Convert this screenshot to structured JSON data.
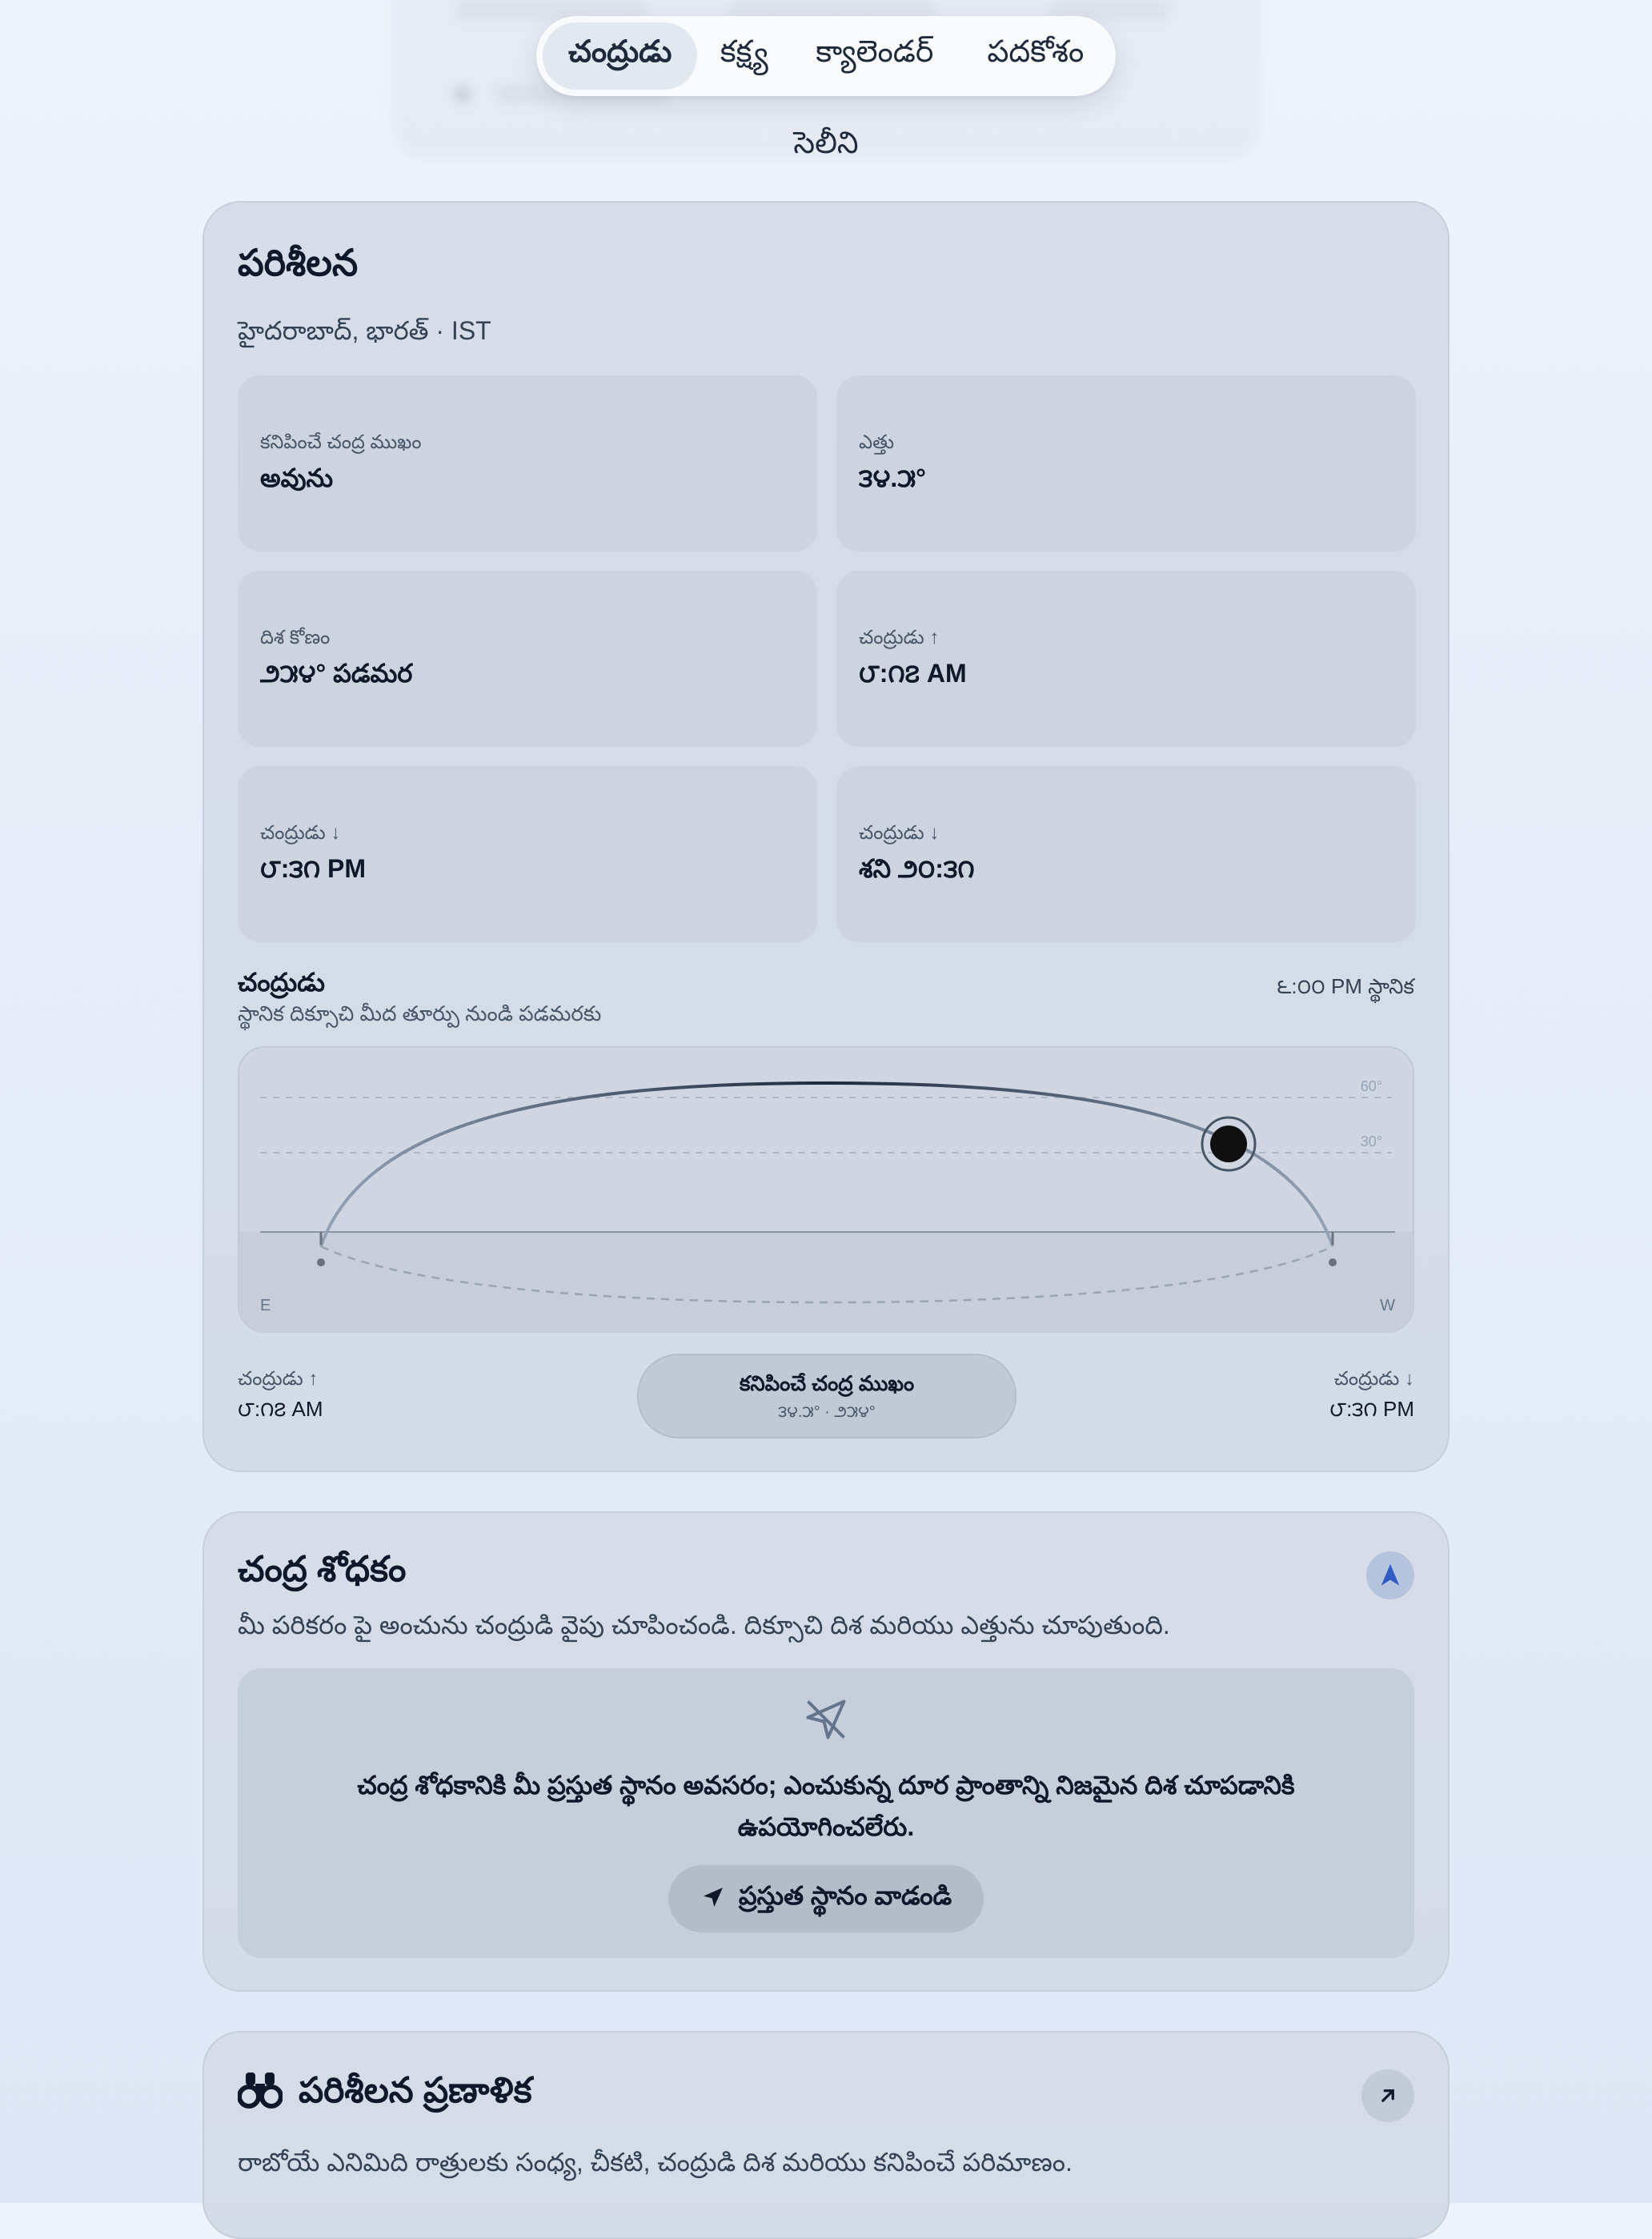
{
  "nav": {
    "tabs": [
      {
        "label": "చంద్రుడు",
        "active": true
      },
      {
        "label": "కక్ష్య"
      },
      {
        "label": "క్యాలెండర్"
      },
      {
        "label": "పదకోశం"
      }
    ],
    "section_title": "సెలీని"
  },
  "observation": {
    "title": "పరిశీలన",
    "location": "హైదరాబాద్, భారత్ · IST",
    "stats": [
      {
        "label": "కనిపించే చంద్ర ముఖం",
        "value": "అవును"
      },
      {
        "label": "ఎత్తు",
        "value": "౩౪.౫°"
      },
      {
        "label": "దిశ కోణం",
        "value": "౨౫౪° పడమర"
      },
      {
        "label": "చంద్రుడు ↑",
        "value": "౮:౧౭ AM"
      },
      {
        "label": "చంద్రుడు ↓",
        "value": "౮:౩౧ PM"
      },
      {
        "label": "చంద్రుడు ↓",
        "value": "శని ౨౦:౩౧"
      }
    ],
    "sky": {
      "title": "చంద్రుడు",
      "subtitle": "స్థానిక దిక్సూచి మీద తూర్పు నుండి పడమరకు",
      "time": "౬:౦౦ PM స్థానిక",
      "grid_60": "60°",
      "grid_30": "30°",
      "east": "E",
      "west": "W",
      "moon_altitude_deg": 34.5
    },
    "footer": {
      "rise_label": "చంద్రుడు ↑",
      "rise_time": "౮:౧౭ AM",
      "set_label": "చంద్రుడు ↓",
      "set_time": "౮:౩౧ PM",
      "pill_title": "కనిపించే చంద్ర ముఖం",
      "pill_sub": "౩౪.౫° · ౨౫౪°"
    }
  },
  "finder": {
    "title": "చంద్ర శోధకం",
    "description": "మీ పరికరం పై అంచును చంద్రుడి వైపు చూపించండి. దిక్సూచి దిశ మరియు ఎత్తును చూపుతుంది.",
    "message_line1": "చంద్ర శోధకానికి మీ ప్రస్తుత స్థానం అవసరం; ఎంచుకున్న దూర ప్రాంతాన్ని నిజమైన దిశ చూపడానికి",
    "message_line2": "ఉపయోగించలేరు.",
    "button": "ప్రస్తుత స్థానం వాడండి"
  },
  "planner": {
    "title": "పరిశీలన ప్రణాళిక",
    "description": "రాబోయే ఎనిమిది రాత్రులకు సంధ్య, చీకటి, చంద్రుడి దిశ మరియు కనిపించే పరిమాణం."
  }
}
